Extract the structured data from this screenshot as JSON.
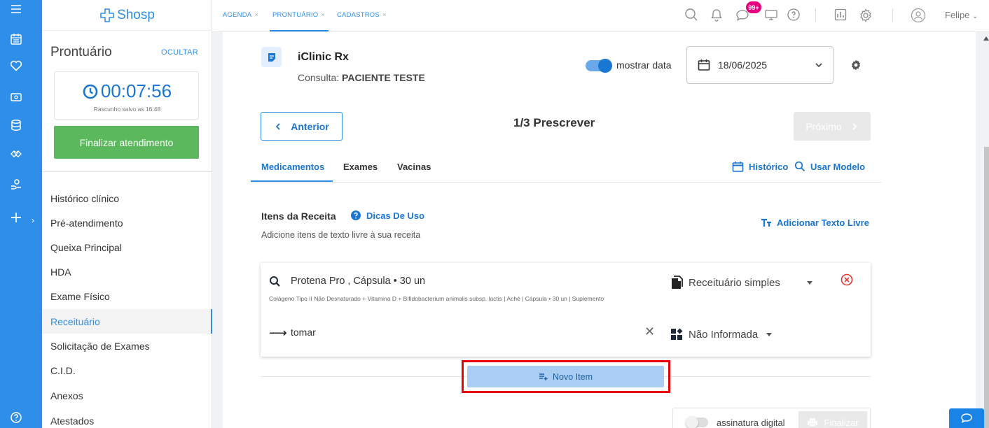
{
  "brand": {
    "name": "Shosp"
  },
  "rail": {
    "icons": [
      "menu-icon",
      "calendar-icon",
      "heart-icon",
      "cash-icon",
      "database-icon",
      "handshake-icon",
      "hand-care-icon",
      "plus-icon",
      "help-icon"
    ]
  },
  "sidebar": {
    "title": "Prontuário",
    "hide_label": "OCULTAR",
    "timer": "00:07:56",
    "saved_text": "Rascunho salvo as 16:48",
    "finish_label": "Finalizar atendimento",
    "items": [
      {
        "label": "Histórico clínico"
      },
      {
        "label": "Pré-atendimento"
      },
      {
        "label": "Queixa Principal"
      },
      {
        "label": "HDA"
      },
      {
        "label": "Exame Físico"
      },
      {
        "label": "Receituário"
      },
      {
        "label": "Solicitação de Exames"
      },
      {
        "label": "C.I.D."
      },
      {
        "label": "Anexos"
      },
      {
        "label": "Atestados"
      }
    ],
    "active_item": "Receituário"
  },
  "header": {
    "tabs": [
      {
        "label": "AGENDA"
      },
      {
        "label": "PRONTUÁRIO"
      },
      {
        "label": "CADASTROS"
      }
    ],
    "active_tab": "PRONTUÁRIO",
    "notification_badge": "99+",
    "user_name": "Felipe"
  },
  "rx": {
    "title": "iClinic Rx",
    "consult_prefix": "Consulta:",
    "patient": "PACIENTE TESTE",
    "show_date_label": "mostrar data",
    "show_date_on": true,
    "date": "18/06/2025",
    "prev_label": "Anterior",
    "step_label": "1/3 Prescrever",
    "next_label": "Próximo",
    "tabs": [
      {
        "label": "Medicamentos"
      },
      {
        "label": "Exames"
      },
      {
        "label": "Vacinas"
      }
    ],
    "history_label": "Histórico",
    "use_model_label": "Usar Modelo",
    "items_title": "Itens da Receita",
    "tips_label": "Dicas De Uso",
    "items_sub": "Adicione itens de texto livre à sua receita",
    "free_text_label": "Adicionar Texto Livre",
    "item": {
      "name": "Protena Pro  , Cápsula • 30 un",
      "description": "Colágeno Tipo II Não Desnaturado + Vitamina D + Bifidobacterium animalis subsp. lactis | Aché | Cápsula • 30 un | Suplemento",
      "dosage": "tomar",
      "prescription_type": "Receituário simples",
      "route": "Não Informada"
    },
    "new_item_label": "Novo Item",
    "digital_signature_label": "assinatura digital",
    "digital_signature_on": false,
    "finalize_label": "Finalizar"
  },
  "colors": {
    "primary": "#2f8fe8",
    "success": "#5cb85c",
    "highlight": "#e8000b",
    "badge": "#e6007e",
    "danger": "#e53935"
  }
}
